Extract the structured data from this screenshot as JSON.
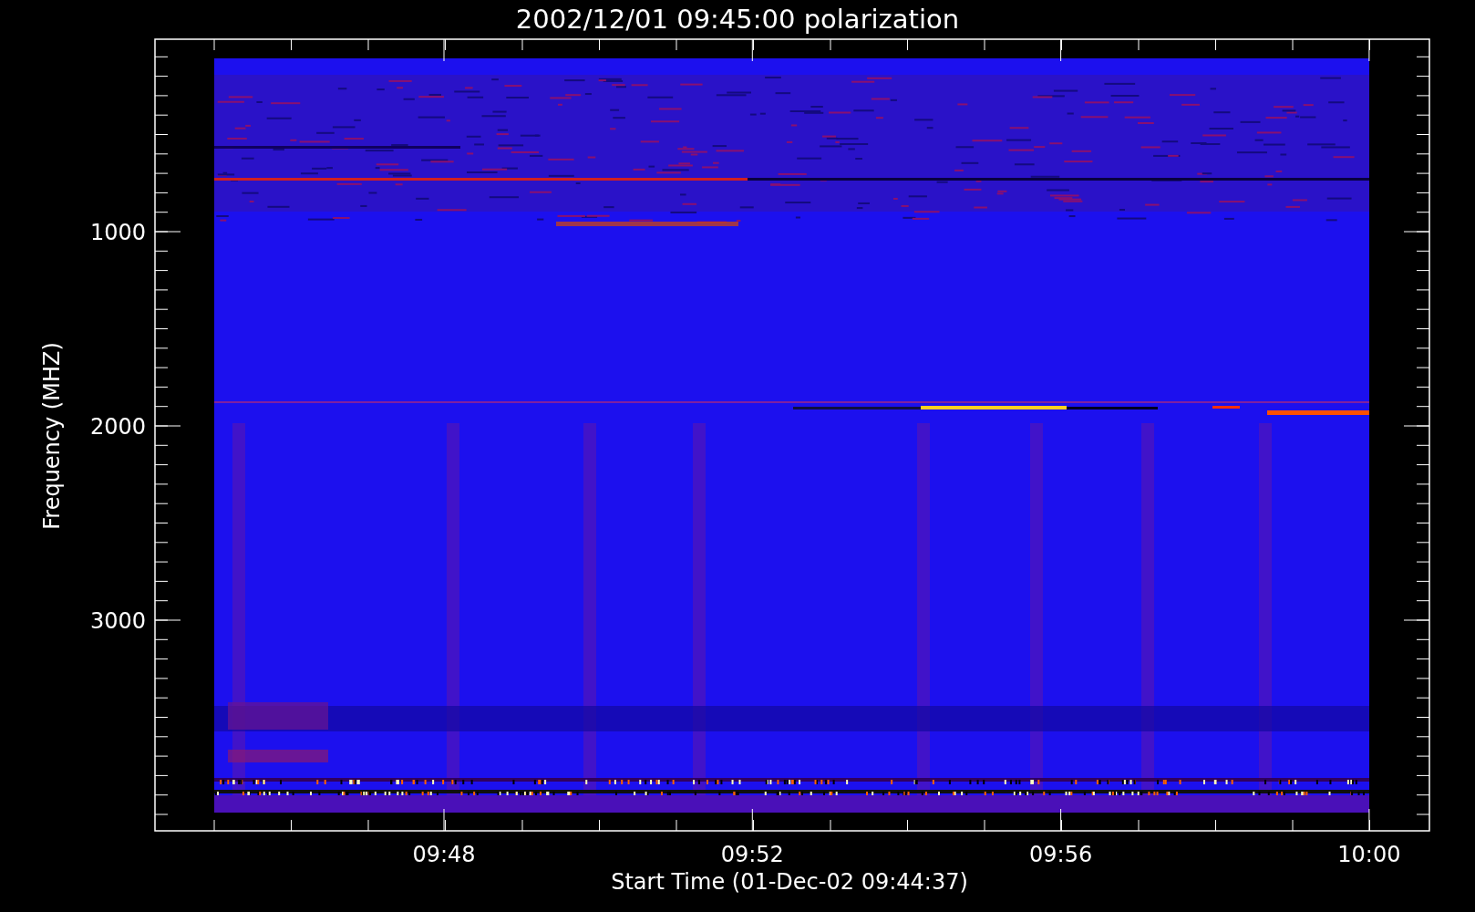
{
  "plot": {
    "title": "2002/12/01 09:45:00 polarization",
    "y_axis": {
      "label": "Frequency (MHZ)",
      "tick_labels": [
        "1000",
        "2000",
        "3000"
      ]
    },
    "x_axis": {
      "label": "Start Time (01-Dec-02 09:44:37)",
      "tick_labels": [
        "09:48",
        "09:52",
        "09:56",
        "10:00"
      ]
    }
  }
}
